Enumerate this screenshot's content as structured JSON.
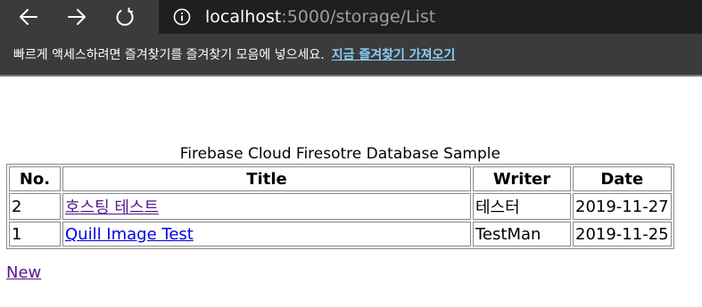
{
  "browser": {
    "url_host": "localhost",
    "url_path": ":5000/storage/List",
    "favorites_prompt": "빠르게 액세스하려면 즐겨찾기를 즐겨찾기 모음에 넣으세요.",
    "favorites_import_link": "지금 즐겨찾기 가져오기",
    "icons": [
      "back-arrow-icon",
      "forward-arrow-icon",
      "refresh-icon",
      "info-icon"
    ]
  },
  "page": {
    "caption": "Firebase Cloud Firesotre Database Sample",
    "columns": [
      "No.",
      "Title",
      "Writer",
      "Date"
    ],
    "rows": [
      {
        "no": "2",
        "title": "호스팅 테스트",
        "writer": "테스터",
        "date": "2019-11-27",
        "visited": true
      },
      {
        "no": "1",
        "title": "Quill Image Test",
        "writer": "TestMan",
        "date": "2019-11-25",
        "visited": false
      }
    ],
    "new_link": "New"
  },
  "colors": {
    "toolbar_bg": "#3b3b3b",
    "address_bg": "#1f1f1f",
    "favorites_link": "#8ccdf6",
    "link_visited": "#551a8b",
    "link_unvisited": "#0000ee"
  }
}
